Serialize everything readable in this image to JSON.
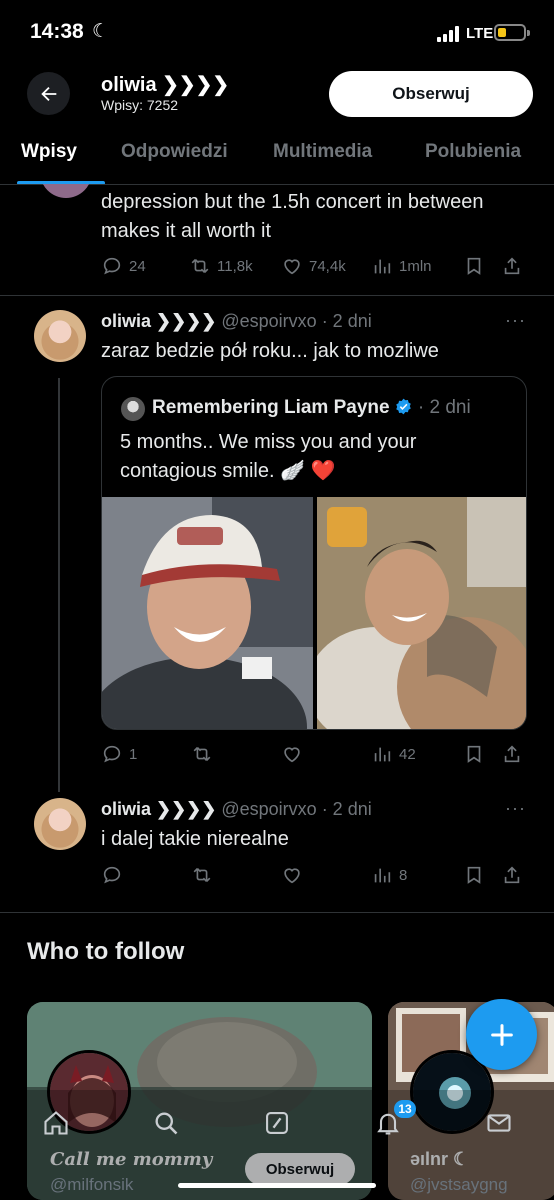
{
  "status_bar": {
    "time": "14:38",
    "network": "LTE",
    "battery_color": "#f5c518"
  },
  "header": {
    "name": "oliwia ❯❯❯❯",
    "posts_count": "Wpisy: 7252",
    "follow_label": "Obserwuj"
  },
  "tabs": [
    {
      "label": "Wpisy",
      "active": true
    },
    {
      "label": "Odpowiedzi",
      "active": false
    },
    {
      "label": "Multimedia",
      "active": false
    },
    {
      "label": "Polubienia",
      "active": false
    }
  ],
  "posts": [
    {
      "text": "depression but the 1.5h concert in between makes it all worth it",
      "stats": {
        "replies": "24",
        "reposts": "11,8k",
        "likes": "74,4k",
        "views": "1mln"
      }
    },
    {
      "author": "oliwia ❯❯❯❯",
      "handle": "@espoirvxo",
      "time": "· 2 dni",
      "text": "zaraz bedzie pół roku... jak to mozliwe",
      "quote": {
        "author": "Remembering Liam Payne",
        "time": "· 2 dni",
        "text": "5 months.. We miss you and your contagious smile. 🪽 ❤️"
      },
      "stats": {
        "replies": "1",
        "reposts": "",
        "likes": "",
        "views": "42"
      }
    },
    {
      "author": "oliwia ❯❯❯❯",
      "handle": "@espoirvxo",
      "time": "· 2 dni",
      "text": "i dalej takie nierealne",
      "stats": {
        "replies": "",
        "reposts": "",
        "likes": "",
        "views": "8"
      }
    }
  ],
  "who_to_follow": {
    "title": "Who to follow",
    "cards": [
      {
        "name": "Call me mommy",
        "handle": "@milfonsik",
        "follow_label": "Obserwuj"
      },
      {
        "name": "əılnr ☾",
        "handle": "@jvstsaygng"
      }
    ]
  },
  "bottom_nav": {
    "notifications_badge": "13"
  },
  "colors": {
    "accent": "#1d9bf0",
    "text_secondary": "#71767b",
    "divider": "#2f3336"
  }
}
